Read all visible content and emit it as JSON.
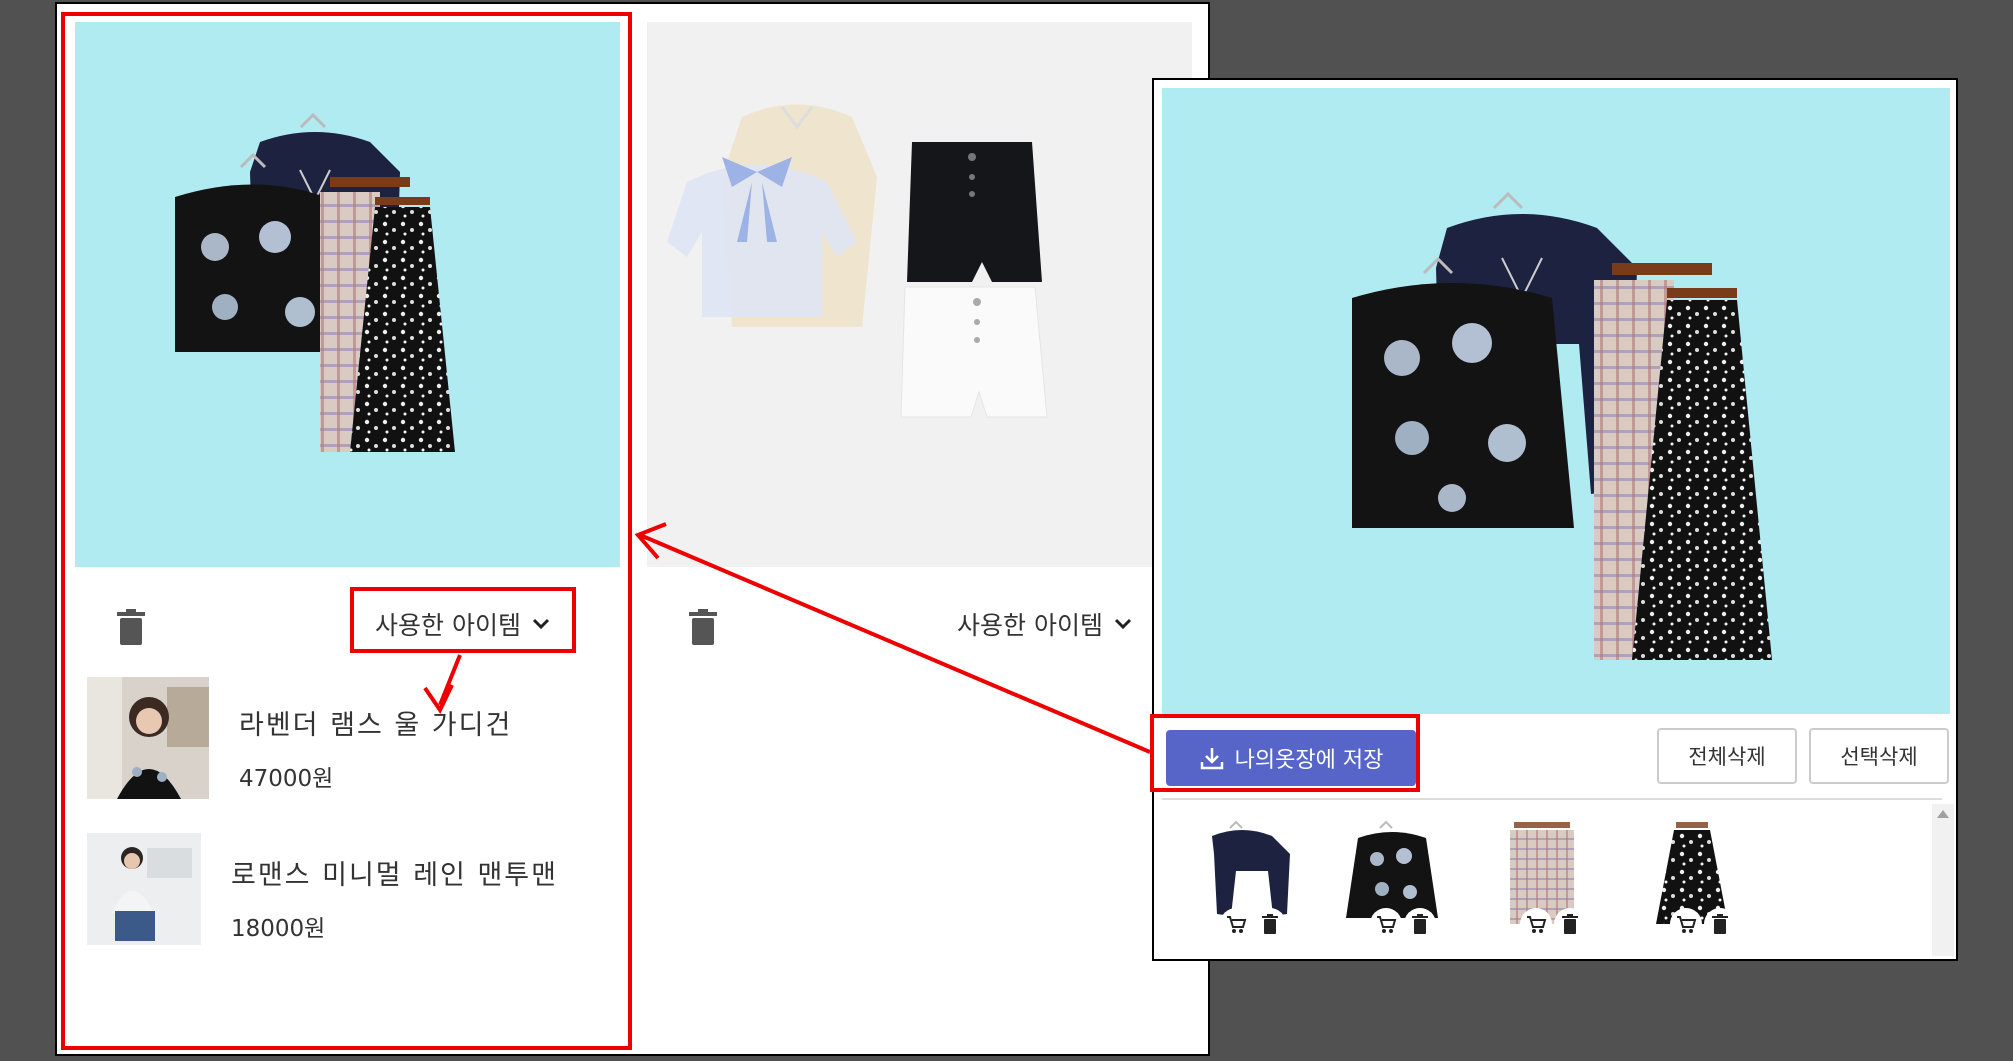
{
  "outfits": [
    {
      "used_label": "사용한 아이템",
      "items": [
        {
          "name": "라벤더 램스 울 가디건",
          "price": "47000원"
        },
        {
          "name": "로맨스 미니멀 레인 맨투맨",
          "price": "18000원"
        }
      ]
    },
    {
      "used_label": "사용한 아이템"
    }
  ],
  "editor": {
    "save_label": "나의옷장에 저장",
    "delete_all_label": "전체삭제",
    "delete_selected_label": "선택삭제",
    "tray": [
      {
        "icon": "navy-sweater"
      },
      {
        "icon": "floral-cardigan"
      },
      {
        "icon": "plaid-skirt"
      },
      {
        "icon": "floral-skirt"
      }
    ]
  },
  "colors": {
    "highlight": "#e00000",
    "primary_button": "#5765c9",
    "preview_bg": "#b1ebf2",
    "backdrop": "#515151"
  }
}
